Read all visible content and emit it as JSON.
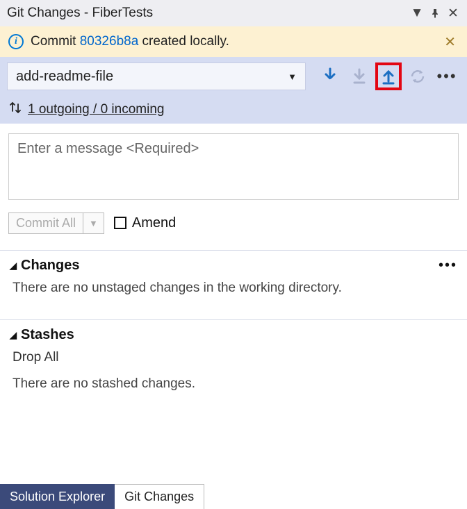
{
  "title": "Git Changes - FiberTests",
  "info": {
    "prefix": "Commit ",
    "hash": "80326b8a",
    "suffix": " created locally."
  },
  "branch": {
    "name": "add-readme-file"
  },
  "sync": {
    "text": "1 outgoing / 0 incoming"
  },
  "message": {
    "placeholder": "Enter a message <Required>"
  },
  "commit": {
    "label": "Commit All"
  },
  "amend": {
    "label": "Amend"
  },
  "changes": {
    "header": "Changes",
    "body": "There are no unstaged changes in the working directory."
  },
  "stashes": {
    "header": "Stashes",
    "drop": "Drop All",
    "body": "There are no stashed changes."
  },
  "tabs": {
    "solution": "Solution Explorer",
    "git": "Git Changes"
  },
  "colors": {
    "accent": "#1b6ec2",
    "highlight": "#e30613"
  }
}
